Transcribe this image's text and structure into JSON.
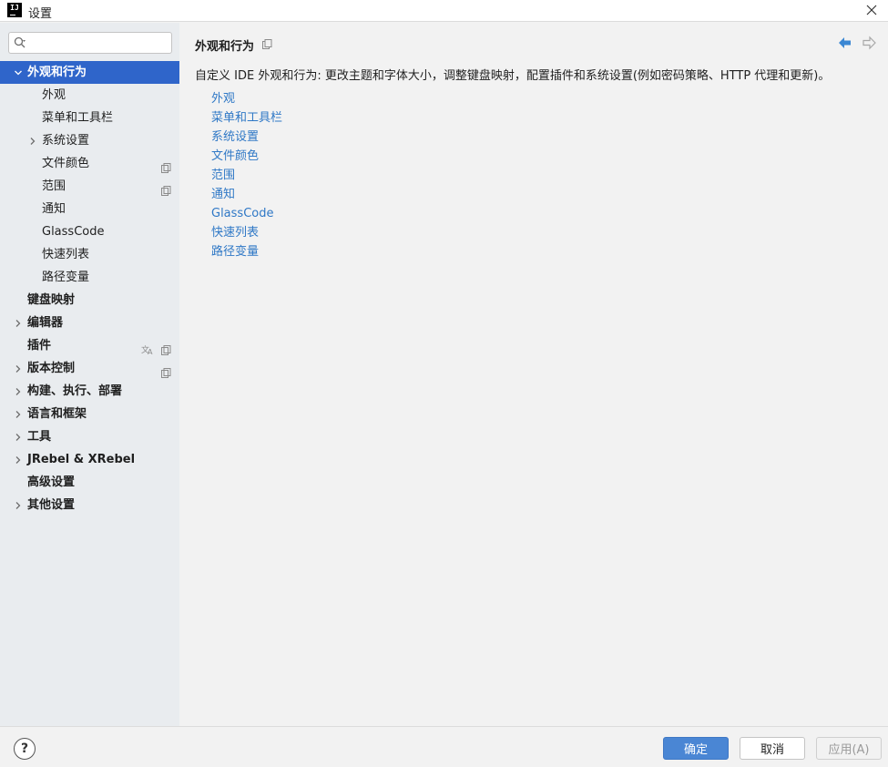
{
  "window": {
    "title": "设置",
    "logo_text": "IJ"
  },
  "search": {
    "placeholder": "",
    "value": ""
  },
  "sidebar": {
    "items": [
      {
        "label": "外观和行为",
        "level": 0,
        "expanded": true,
        "selected": true,
        "bold": true
      },
      {
        "label": "外观",
        "level": 1
      },
      {
        "label": "菜单和工具栏",
        "level": 1
      },
      {
        "label": "系统设置",
        "level": 1,
        "collapsed": true
      },
      {
        "label": "文件颜色",
        "level": 1,
        "icon": "copy-icon"
      },
      {
        "label": "范围",
        "level": 1,
        "icon": "copy-icon"
      },
      {
        "label": "通知",
        "level": 1
      },
      {
        "label": "GlassCode",
        "level": 1
      },
      {
        "label": "快速列表",
        "level": 1
      },
      {
        "label": "路径变量",
        "level": 1
      },
      {
        "label": "键盘映射",
        "level": 0,
        "bold": true
      },
      {
        "label": "编辑器",
        "level": 0,
        "bold": true,
        "collapsed": true
      },
      {
        "label": "插件",
        "level": 0,
        "bold": true,
        "icons": [
          "translate-icon",
          "copy-icon"
        ]
      },
      {
        "label": "版本控制",
        "level": 0,
        "bold": true,
        "collapsed": true,
        "icon": "copy-icon"
      },
      {
        "label": "构建、执行、部署",
        "level": 0,
        "bold": true,
        "collapsed": true
      },
      {
        "label": "语言和框架",
        "level": 0,
        "bold": true,
        "collapsed": true
      },
      {
        "label": "工具",
        "level": 0,
        "bold": true,
        "collapsed": true
      },
      {
        "label": "JRebel & XRebel",
        "level": 0,
        "bold": true,
        "collapsed": true
      },
      {
        "label": "高级设置",
        "level": 0,
        "bold": true
      },
      {
        "label": "其他设置",
        "level": 0,
        "bold": true,
        "collapsed": true
      }
    ]
  },
  "main": {
    "title": "外观和行为",
    "description": "自定义 IDE 外观和行为: 更改主题和字体大小，调整键盘映射，配置插件和系统设置(例如密码策略、HTTP 代理和更新)。",
    "links": [
      "外观",
      "菜单和工具栏",
      "系统设置",
      "文件颜色",
      "范围",
      "通知",
      "GlassCode",
      "快速列表",
      "路径变量"
    ]
  },
  "buttons": {
    "help": "?",
    "ok": "确定",
    "cancel": "取消",
    "apply": "应用(A)"
  },
  "colors": {
    "selection": "#2f65ca",
    "link": "#2f78c6",
    "primary_button": "#4a86d4"
  }
}
